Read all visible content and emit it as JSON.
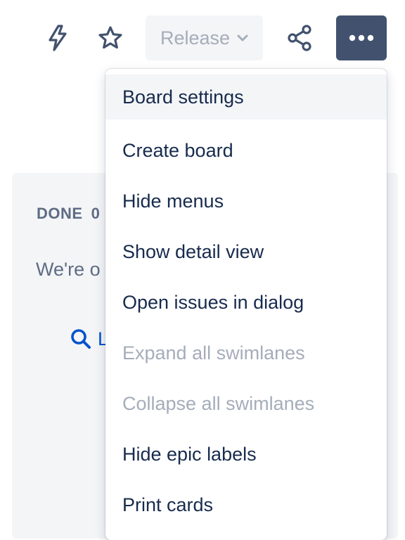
{
  "toolbar": {
    "release_label": "Release",
    "icons": {
      "automation": "lightning-bolt-icon",
      "star": "star-icon",
      "share": "share-icon",
      "more": "more-horizontal-icon",
      "release_chevron": "chevron-down-icon"
    }
  },
  "column": {
    "title": "DONE",
    "count": "0",
    "empty_text": "We're o",
    "search_text": "L"
  },
  "menu": {
    "items": [
      {
        "label": "Board settings",
        "state": "highlighted"
      },
      {
        "label": "Create board",
        "state": "enabled"
      },
      {
        "label": "Hide menus",
        "state": "enabled"
      },
      {
        "label": "Show detail view",
        "state": "enabled"
      },
      {
        "label": "Open issues in dialog",
        "state": "enabled"
      },
      {
        "label": "Expand all swimlanes",
        "state": "disabled"
      },
      {
        "label": "Collapse all swimlanes",
        "state": "disabled"
      },
      {
        "label": "Hide epic labels",
        "state": "enabled"
      },
      {
        "label": "Print cards",
        "state": "enabled"
      }
    ]
  },
  "colors": {
    "text_primary": "#172b4d",
    "text_disabled": "#a5adba",
    "text_subtle": "#5e6c84",
    "link": "#0052cc",
    "more_button_bg": "#42526e",
    "surface_gray": "#f4f5f7"
  }
}
